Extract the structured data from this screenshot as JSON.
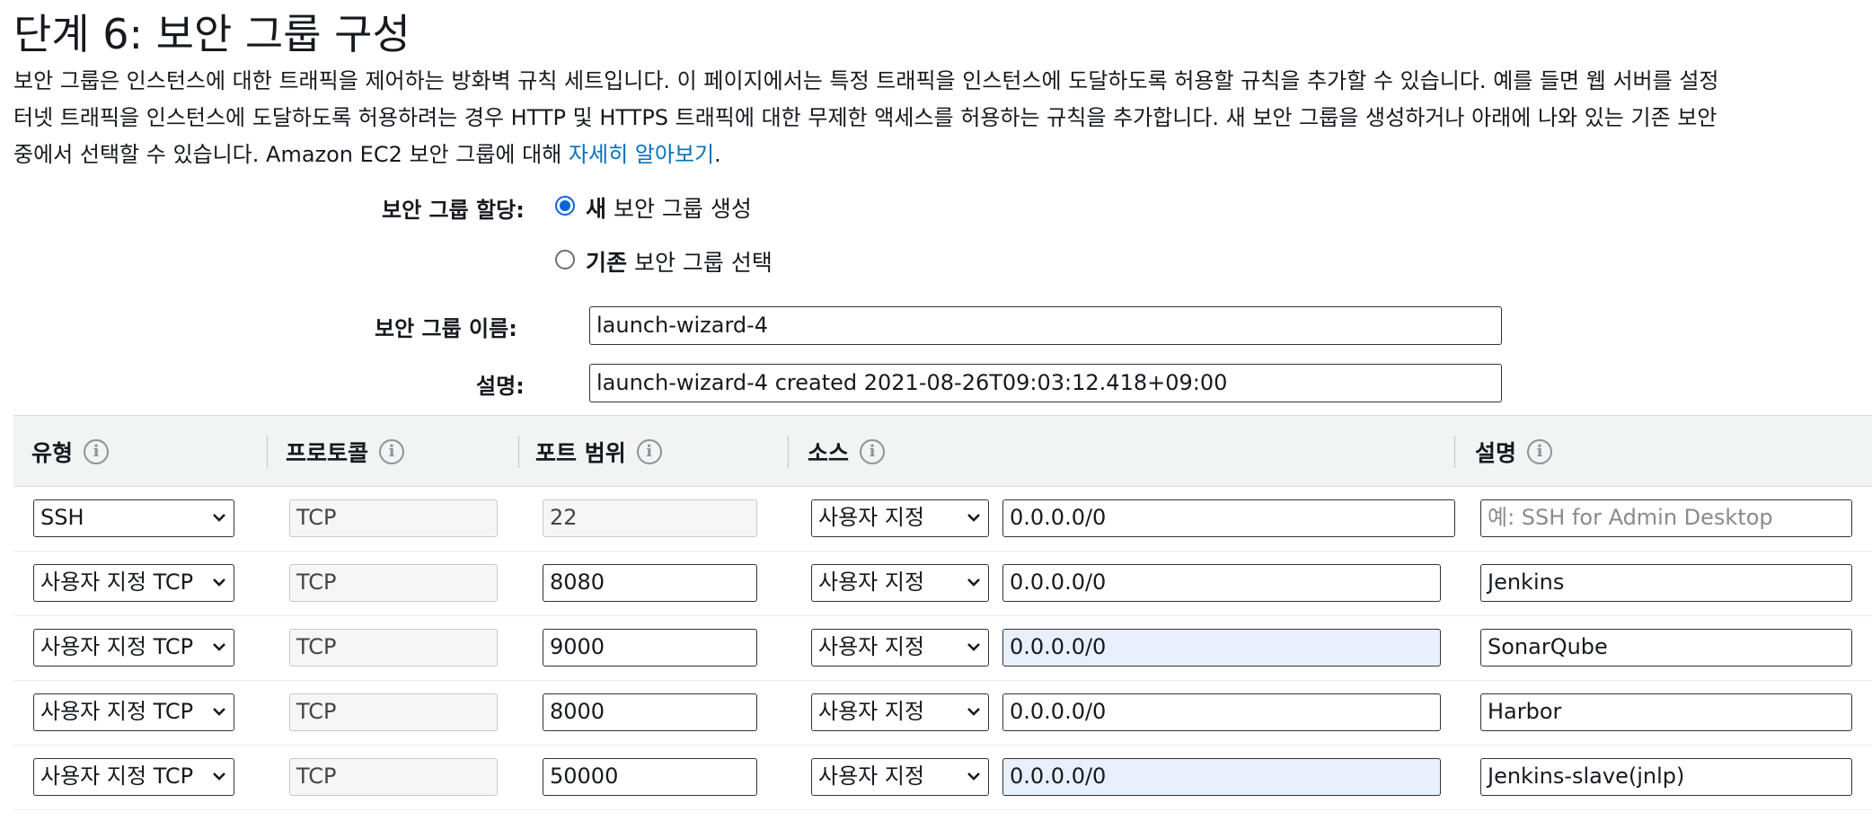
{
  "page": {
    "title": "단계 6: 보안 그룹 구성",
    "description_lines": [
      "보안 그룹은 인스턴스에 대한 트래픽을 제어하는 방화벽 규칙 세트입니다. 이 페이지에서는 특정 트래픽을 인스턴스에 도달하도록 허용할 규칙을 추가할 수 있습니다. 예를 들면 웹 서버를 설정",
      "터넷 트래픽을 인스턴스에 도달하도록 허용하려는 경우 HTTP 및 HTTPS 트래픽에 대한 무제한 액세스를 허용하는 규칙을 추가합니다. 새 보안 그룹을 생성하거나 아래에 나와 있는 기존 보안"
    ],
    "description_line3_prefix": "중에서 선택할 수 있습니다. Amazon EC2 보안 그룹에 대해 ",
    "learn_more_link": "자세히 알아보기",
    "description_line3_suffix": "."
  },
  "form": {
    "assign_label": "보안 그룹 할당:",
    "option_new_bold": "새",
    "option_new_rest": " 보안 그룹 생성",
    "option_new_selected": true,
    "option_existing_bold": "기존",
    "option_existing_rest": " 보안 그룹 선택",
    "name_label": "보안 그룹 이름:",
    "name_value": "launch-wizard-4",
    "description_label": "설명:",
    "description_value": "launch-wizard-4 created 2021-08-26T09:03:12.418+09:00"
  },
  "table": {
    "headers": {
      "type": "유형",
      "protocol": "프로토콜",
      "port_range": "포트 범위",
      "source": "소스",
      "description": "설명"
    },
    "info_icon": "i",
    "rows": [
      {
        "type": "SSH",
        "protocol": "TCP",
        "port": "22",
        "source_mode": "사용자 지정",
        "source": "0.0.0.0/0",
        "description": "예: SSH for Admin Desktop"
      },
      {
        "type": "사용자 지정 TCP",
        "protocol": "TCP",
        "port": "8080",
        "source_mode": "사용자 지정",
        "source": "0.0.0.0/0",
        "description": "Jenkins"
      },
      {
        "type": "사용자 지정 TCP",
        "protocol": "TCP",
        "port": "9000",
        "source_mode": "사용자 지정",
        "source": "0.0.0.0/0",
        "description": "SonarQube"
      },
      {
        "type": "사용자 지정 TCP",
        "protocol": "TCP",
        "port": "8000",
        "source_mode": "사용자 지정",
        "source": "0.0.0.0/0",
        "description": "Harbor"
      },
      {
        "type": "사용자 지정 TCP",
        "protocol": "TCP",
        "port": "50000",
        "source_mode": "사용자 지정",
        "source": "0.0.0.0/0",
        "description": "Jenkins-slave(jnlp)"
      }
    ]
  },
  "colors": {
    "link": "#0073bb",
    "radio_selected": "#0a66d8",
    "header_bg": "#f2f3f3",
    "autofill_bg": "#e8f0fe"
  }
}
